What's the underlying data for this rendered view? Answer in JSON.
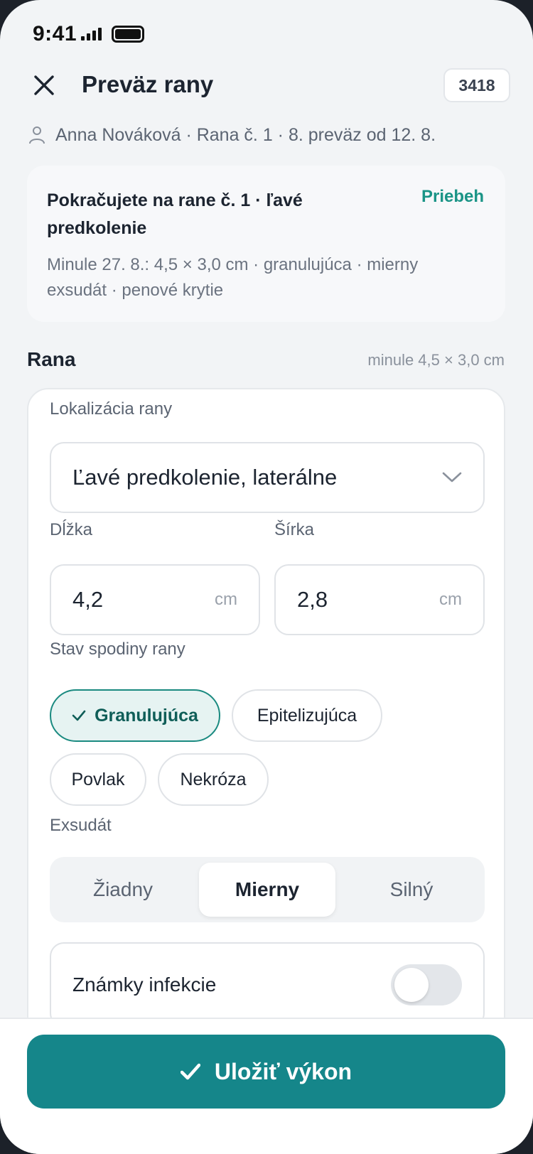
{
  "status_bar": {
    "time": "9:41"
  },
  "header": {
    "title": "Preväz rany",
    "record_id": "3418"
  },
  "patient": {
    "summary": "Anna Nováková · Rana č. 1 · 8. preväz od 12. 8."
  },
  "continuation": {
    "title": "Pokračujete na rane č. 1 · ľavé predkolenie",
    "status": "Priebeh",
    "previous": "Minule 27. 8.: 4,5 × 3,0 cm · granulujúca · mierny exsudát · penové krytie"
  },
  "section": {
    "title": "Rana",
    "hint": "minule 4,5 × 3,0 cm"
  },
  "form": {
    "location": {
      "label": "Lokalizácia rany",
      "value": "Ľavé predkolenie, laterálne"
    },
    "length": {
      "label": "Dĺžka",
      "value": "4,2",
      "unit": "cm"
    },
    "width": {
      "label": "Šírka",
      "value": "2,8",
      "unit": "cm"
    },
    "wound_bed": {
      "label": "Stav spodiny rany",
      "options": [
        "Granulujúca",
        "Epitelizujúca",
        "Povlak",
        "Nekróza"
      ],
      "selected": "Granulujúca"
    },
    "exudate": {
      "label": "Exsudát",
      "options": [
        "Žiadny",
        "Mierny",
        "Silný"
      ],
      "selected": "Mierny"
    },
    "infection": {
      "label": "Známky infekcie",
      "on": false
    }
  },
  "actions": {
    "save_label": "Uložiť výkon"
  },
  "colors": {
    "accent": "#15868a",
    "status_green": "#1a9486",
    "selected_chip_bg": "#e6f3f2"
  }
}
